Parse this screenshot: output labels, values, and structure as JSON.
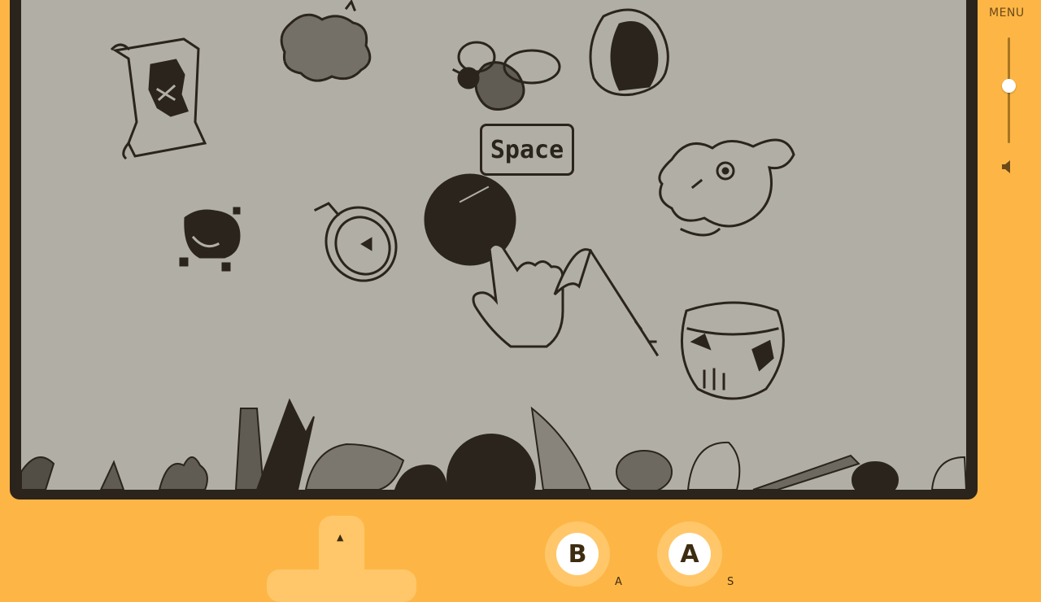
{
  "sidebar": {
    "menu_label": "MENU",
    "volume_level": 0.55
  },
  "screen": {
    "key_prompt": "Space"
  },
  "controls": {
    "dpad_up": "▲",
    "b_label": "B",
    "a_label": "A",
    "b_key_hint": "A",
    "a_key_hint": "S"
  },
  "colors": {
    "shell": "#FDB646",
    "screen": "#b1aea5",
    "ink": "#2a241c"
  }
}
